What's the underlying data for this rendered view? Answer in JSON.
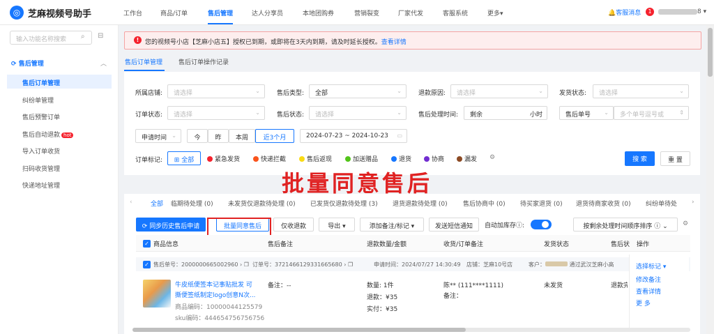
{
  "app": {
    "title": "芝麻视频号助手",
    "logo_icon": "sesame-logo-icon"
  },
  "topnav": {
    "items": [
      "工作台",
      "商品/订单",
      "售后管理",
      "达人分享员",
      "本地团购券",
      "营销裂变",
      "厂家代发",
      "客服系统",
      "更多▾"
    ],
    "active": "售后管理"
  },
  "header_right": {
    "service": "客服消息",
    "badge": "1",
    "account_suffix": "8 ▾"
  },
  "sidebar": {
    "search_placeholder": "输入功能名称搜索",
    "group": "售后管理",
    "items": [
      "售后订单管理",
      "纠纷单管理",
      "售后预警订单",
      "售后自动退款",
      "导入订单收货",
      "扫码收货管理",
      "快递地址管理"
    ],
    "hot": "hot",
    "active": "售后订单管理"
  },
  "alert": {
    "text": "您的视频号小店【芝麻小店五】授权已到期，或即将在3天内到期，请及时延长授权。",
    "link": "查看详情"
  },
  "subtabs": [
    "售后订单管理",
    "售后订单操作记录"
  ],
  "filters": {
    "shop_label": "所属店铺:",
    "shop_placeholder": "请选择",
    "type_label": "售后类型:",
    "type_value": "全部",
    "reason_label": "退款原因:",
    "reason_placeholder": "请选择",
    "ship_label": "发货状态:",
    "ship_placeholder": "请选择",
    "order_status_label": "订单状态:",
    "order_status_placeholder": "请选择",
    "as_status_label": "售后状态:",
    "as_status_placeholder": "请选择",
    "proc_time_label": "售后处理时间:",
    "remaining": "剩余",
    "hours": "小时",
    "as_no_label": "售后单号",
    "multi_placeholder": "多个单号逗号或",
    "apply_time": "申请时间",
    "quick": [
      "今",
      "昨",
      "本周",
      "近3个月"
    ],
    "quick_active": "近3个月",
    "date_from": "2024-07-23",
    "date_sep": "~",
    "date_to": "2024-10-23"
  },
  "tags": {
    "label": "订单标记:",
    "all": "全部",
    "items": [
      {
        "name": "紧急发货",
        "color": "#f5222d"
      },
      {
        "name": "快递拦截",
        "color": "#fa541c"
      },
      {
        "name": "售后返现",
        "color": "#fadb14"
      },
      {
        "name": "加送赠品",
        "color": "#52c41a"
      },
      {
        "name": "退货",
        "color": "#1677ff"
      },
      {
        "name": "协商",
        "color": "#722ed1"
      },
      {
        "name": "漏发",
        "color": "#8c4a24"
      }
    ]
  },
  "buttons": {
    "search": "搜 索",
    "reset": "重 置"
  },
  "overlay_text": "批量同意售后",
  "status_tabs": [
    {
      "label": "全部"
    },
    {
      "label": "临期待处理",
      "count": "(0)"
    },
    {
      "label": "未发货仅退款待处理",
      "count": "(0)"
    },
    {
      "label": "已发货仅退款待处理",
      "count": "(3)"
    },
    {
      "label": "退货退款待处理",
      "count": "(0)"
    },
    {
      "label": "售后协商中",
      "count": "(0)"
    },
    {
      "label": "待买家退货",
      "count": "(0)"
    },
    {
      "label": "退货待商家收货",
      "count": "(0)"
    },
    {
      "label": "纠纷单待处"
    }
  ],
  "actions": {
    "sync": "同步历史售后申请",
    "batch_agree": "批量同意售后",
    "refund_only": "仅收退款",
    "export": "导出 ▾",
    "add_note": "添加备注/标记 ▾",
    "sms": "发送短信通知",
    "auto_encrypt": "自动加库存",
    "sort": "按剩余处理时间顺序排序"
  },
  "table": {
    "headers": [
      "商品信息",
      "售后备注",
      "退款数量/金额",
      "收货/订单备注",
      "发货状态",
      "售后状",
      "操作"
    ]
  },
  "order": {
    "as_no": "售后单号：2000000665002960",
    "order_no": "订单号：3721466129331665680",
    "apply_time": "申请时间：2024/07/27 14:30:49",
    "shop": "店铺：芝麻10号店",
    "buyer": "客户：",
    "buyer_extra": "通过武汉芝麻小高",
    "product_title_1": "牛皮纸便签本记事贴批发 可",
    "product_title_2": "撕便签纸制定logo创意N次...",
    "product_code": "商品编码：10000044125579",
    "sku_code": "sku编码：444654756756756",
    "note": "备注：--",
    "qty": "数量: 1件",
    "refund": "退款：¥35",
    "paid": "实付：¥35",
    "receiver": "陈** (111****1111)",
    "order_note": "备注：",
    "ship_status": "未发货",
    "as_status": "退款完",
    "op_mark": "选择标记 ▾",
    "op_edit": "修改备注",
    "op_detail": "查看详情",
    "op_more": "更 多"
  }
}
